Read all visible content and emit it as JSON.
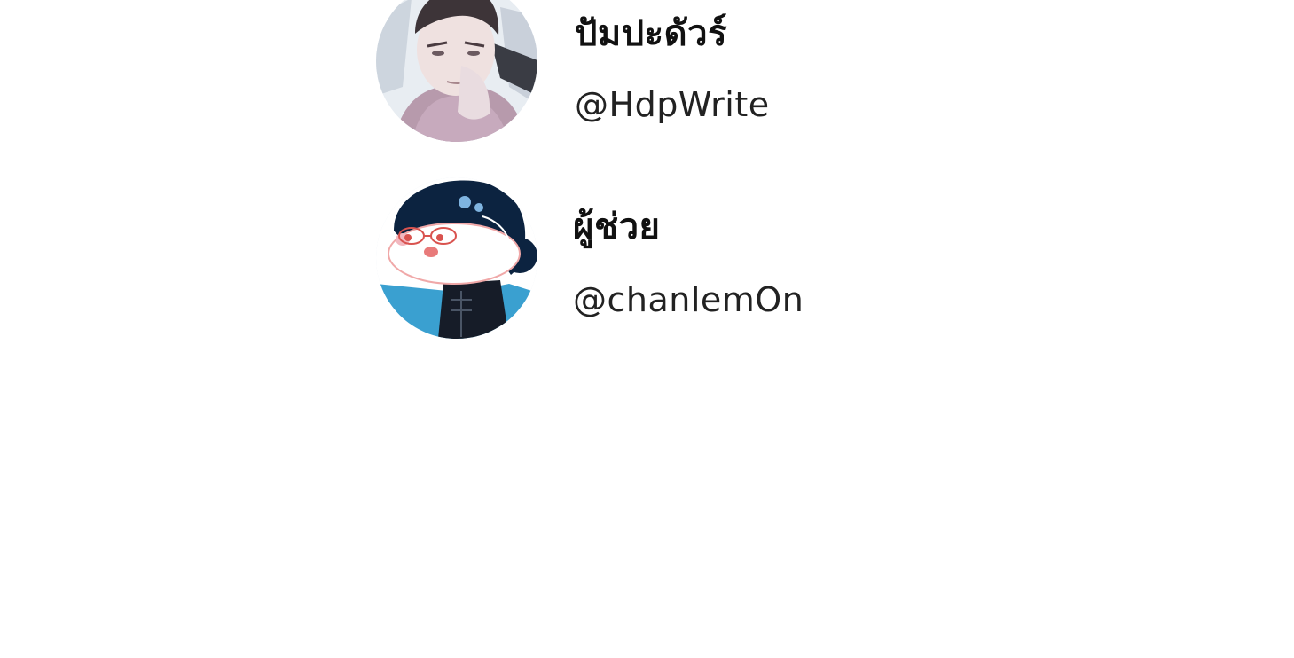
{
  "colors": {
    "background": "#ffffff",
    "name_text": "#111111",
    "handle_text": "#222222"
  },
  "profiles": [
    {
      "name": "ปัมปะดัวร์",
      "handle": "@HdpWrite",
      "avatar_icon": "illustrated-man-avatar-icon"
    },
    {
      "name": "ผู้ช่วย",
      "handle": "@chanlemOn",
      "avatar_icon": "illustrated-girl-avatar-icon"
    }
  ]
}
